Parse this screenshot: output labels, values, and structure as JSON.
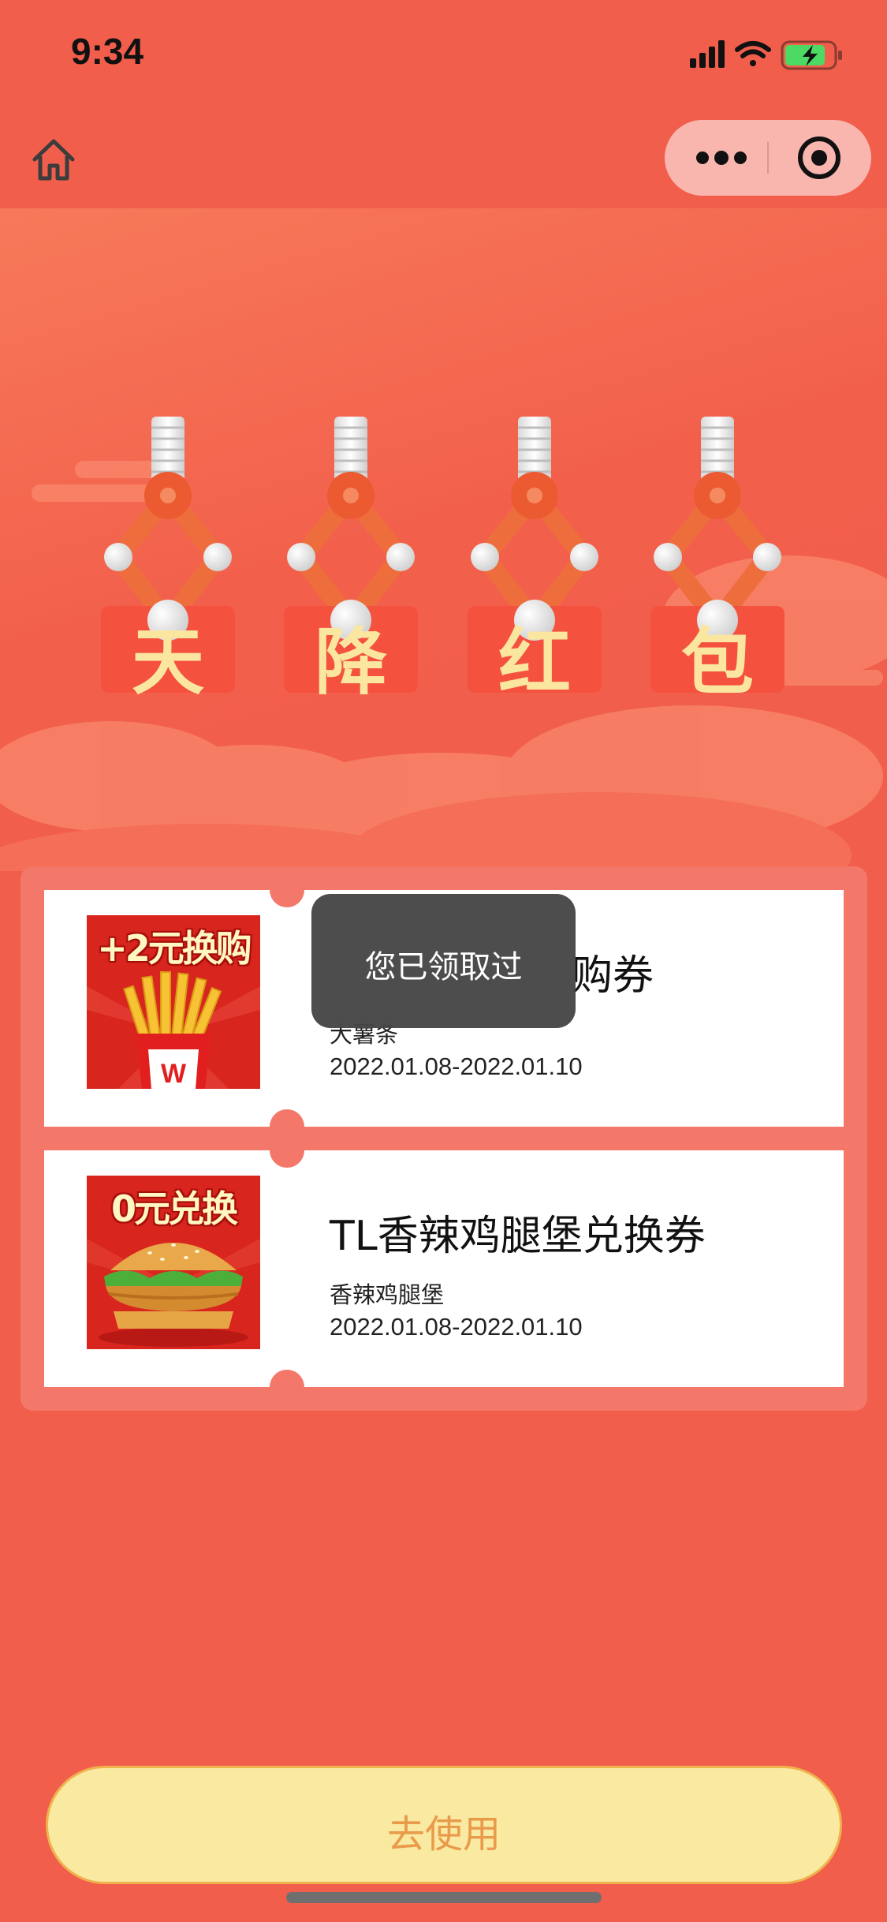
{
  "status_bar": {
    "time": "9:34",
    "icons": [
      "signal-icon",
      "wifi-icon",
      "battery-charging-icon"
    ]
  },
  "nav": {
    "home_icon": "home-icon",
    "more_icon": "more-dots-icon",
    "close_icon": "target-close-icon"
  },
  "banner": {
    "characters": [
      "天",
      "降",
      "红",
      "包"
    ],
    "colors": {
      "envelope": "#f4513f",
      "glyph": "#fbe6a0",
      "claw": "#ef6a3a"
    }
  },
  "coupons": [
    {
      "title": "购券",
      "subtitle": "大薯条",
      "date": "2022.01.08-2022.01.10",
      "image_label": "+2元换购"
    },
    {
      "title": "TL香辣鸡腿堡兑换券",
      "subtitle": "香辣鸡腿堡",
      "date": "2022.01.08-2022.01.10",
      "image_label": "0元兑换"
    }
  ],
  "toast": {
    "text": "您已领取过"
  },
  "action": {
    "use_label": "去使用"
  },
  "colors": {
    "page_bg": "#f15e4c",
    "panel_bg": "#f37869",
    "button_bg": "#f9e9a1",
    "button_text": "#e99a4a"
  }
}
